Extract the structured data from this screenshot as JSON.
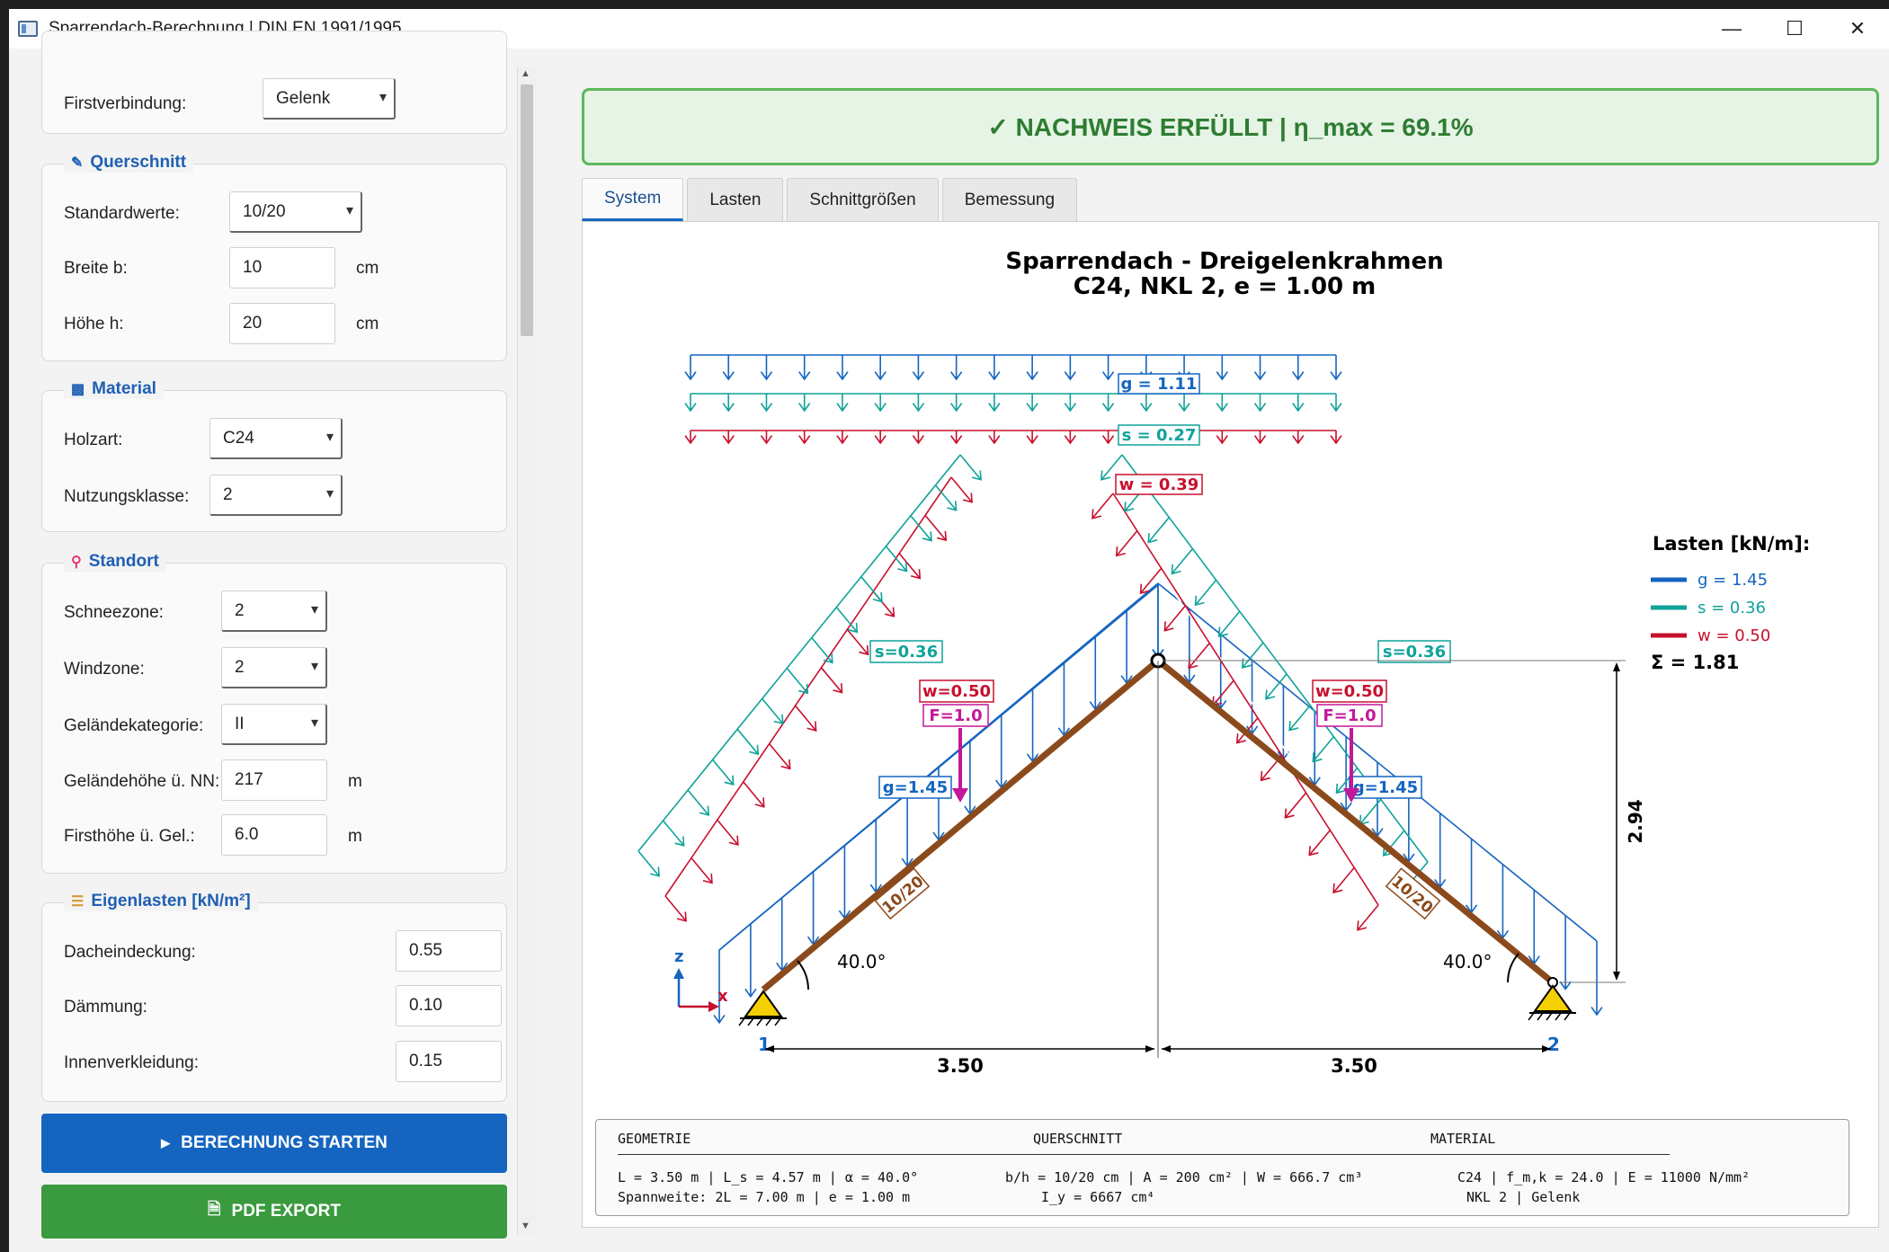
{
  "window": {
    "title": "Sparrendach-Berechnung | DIN EN 1991/1995",
    "controls": [
      "—",
      "☐",
      "✕"
    ]
  },
  "form": {
    "top_group": {
      "label": "Firstverbindung:",
      "value": "Gelenk"
    },
    "querschnitt": {
      "title": "Querschnitt",
      "icon": "ruler-icon",
      "standard_label": "Standardwerte:",
      "standard_value": "10/20",
      "breite_label": "Breite b:",
      "breite_value": "10",
      "breite_unit": "cm",
      "hoehe_label": "Höhe h:",
      "hoehe_value": "20",
      "hoehe_unit": "cm"
    },
    "material": {
      "title": "Material",
      "icon": "wood-icon",
      "holzart_label": "Holzart:",
      "holzart_value": "C24",
      "nkl_label": "Nutzungsklasse:",
      "nkl_value": "2"
    },
    "standort": {
      "title": "Standort",
      "icon": "pin-icon",
      "schnee_label": "Schneezone:",
      "schnee_value": "2",
      "wind_label": "Windzone:",
      "wind_value": "2",
      "gelaende_label": "Geländekategorie:",
      "gelaende_value": "II",
      "nn_label": "Geländehöhe ü. NN:",
      "nn_value": "217",
      "nn_unit": "m",
      "first_label": "Firsthöhe ü. Gel.:",
      "first_value": "6.0",
      "first_unit": "m"
    },
    "eigenlasten": {
      "title": "Eigenlasten [kN/m²]",
      "icon": "layers-icon",
      "dach_label": "Dacheindeckung:",
      "dach_value": "0.55",
      "daemm_label": "Dämmung:",
      "daemm_value": "0.10",
      "innen_label": "Innenverkleidung:",
      "innen_value": "0.15"
    },
    "buttons": {
      "start": "BERECHNUNG STARTEN",
      "export": "PDF EXPORT"
    }
  },
  "result": {
    "banner": "✓ NACHWEIS ERFÜLLT  |  η_max = 69.1%"
  },
  "tabs": [
    "System",
    "Lasten",
    "Schnittgrößen",
    "Bemessung"
  ],
  "plot": {
    "title_line1": "Sparrendach - Dreigelenkrahmen",
    "title_line2": "C24, NKL 2, e = 1.00 m",
    "top_loads": {
      "g": "g = 1.11",
      "s": "s = 0.27",
      "w": "w = 0.39"
    },
    "rafter_labels": {
      "s_left": "s=0.36",
      "w_left": "w=0.50",
      "f_left": "F=1.0",
      "g_left": "g=1.45",
      "s_right": "s=0.36",
      "w_right": "w=0.50",
      "f_right": "F=1.0",
      "g_right": "g=1.45",
      "section_left": "10/20",
      "section_right": "10/20"
    },
    "angle_left": "40.0°",
    "angle_right": "40.0°",
    "height": "2.94",
    "span_left": "3.50",
    "span_right": "3.50",
    "support_left": "1",
    "support_right": "2",
    "axis_z": "z",
    "axis_x": "x",
    "legend": {
      "title": "Lasten [kN/m]:",
      "g": "g = 1.45",
      "s": "s = 0.36",
      "w": "w = 0.50",
      "sum": "Σ = 1.81"
    },
    "colors": {
      "g": "#1565c0",
      "s": "#0fa39a",
      "w": "#c8102e",
      "f": "#c2189a",
      "rafter": "#8b4a1c"
    }
  },
  "info": {
    "h1": "GEOMETRIE",
    "h2": "QUERSCHNITT",
    "h3": "MATERIAL",
    "geo1": "L = 3.50 m | L_s = 4.57 m | α = 40.0°",
    "geo2": "Spannweite: 2L = 7.00 m | e = 1.00 m",
    "qs1": "b/h = 10/20 cm | A = 200 cm² | W = 666.7 cm³",
    "qs2": "I_y = 6667 cm⁴",
    "mat1": "C24 | f_m,k = 24.0 | E = 11000 N/mm²",
    "mat2": "NKL 2 | Gelenk"
  }
}
